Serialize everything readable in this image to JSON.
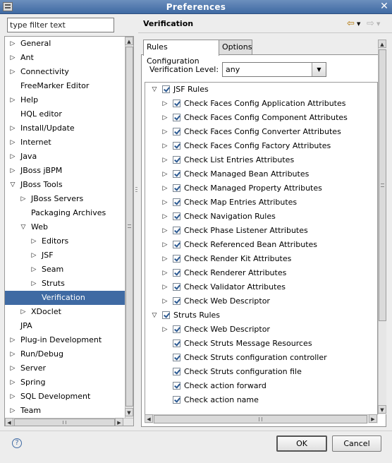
{
  "window": {
    "title": "Preferences",
    "close_glyph": "✕"
  },
  "filter": {
    "placeholder": "type filter text",
    "value": "type filter text"
  },
  "left_tree": [
    {
      "label": "General",
      "expander": "collapsed",
      "level": 0
    },
    {
      "label": "Ant",
      "expander": "collapsed",
      "level": 0
    },
    {
      "label": "Connectivity",
      "expander": "collapsed",
      "level": 0
    },
    {
      "label": "FreeMarker Editor",
      "expander": "none",
      "level": 0
    },
    {
      "label": "Help",
      "expander": "collapsed",
      "level": 0
    },
    {
      "label": "HQL editor",
      "expander": "none",
      "level": 0
    },
    {
      "label": "Install/Update",
      "expander": "collapsed",
      "level": 0
    },
    {
      "label": "Internet",
      "expander": "collapsed",
      "level": 0
    },
    {
      "label": "Java",
      "expander": "collapsed",
      "level": 0
    },
    {
      "label": "JBoss jBPM",
      "expander": "collapsed",
      "level": 0
    },
    {
      "label": "JBoss Tools",
      "expander": "expanded",
      "level": 0
    },
    {
      "label": "JBoss Servers",
      "expander": "collapsed",
      "level": 1
    },
    {
      "label": "Packaging Archives",
      "expander": "none",
      "level": 1
    },
    {
      "label": "Web",
      "expander": "expanded",
      "level": 1
    },
    {
      "label": "Editors",
      "expander": "collapsed",
      "level": 2
    },
    {
      "label": "JSF",
      "expander": "collapsed",
      "level": 2
    },
    {
      "label": "Seam",
      "expander": "collapsed",
      "level": 2
    },
    {
      "label": "Struts",
      "expander": "collapsed",
      "level": 2
    },
    {
      "label": "Verification",
      "expander": "none",
      "level": 2,
      "selected": true
    },
    {
      "label": "XDoclet",
      "expander": "collapsed",
      "level": 1
    },
    {
      "label": "JPA",
      "expander": "none",
      "level": 0
    },
    {
      "label": "Plug-in Development",
      "expander": "collapsed",
      "level": 0
    },
    {
      "label": "Run/Debug",
      "expander": "collapsed",
      "level": 0
    },
    {
      "label": "Server",
      "expander": "collapsed",
      "level": 0
    },
    {
      "label": "Spring",
      "expander": "collapsed",
      "level": 0
    },
    {
      "label": "SQL Development",
      "expander": "collapsed",
      "level": 0
    },
    {
      "label": "Team",
      "expander": "collapsed",
      "level": 0
    }
  ],
  "page": {
    "title": "Verification",
    "back_icon": "back-arrow-icon",
    "forward_icon": "forward-arrow-icon"
  },
  "tabs": [
    {
      "label": "Rules Configuration",
      "active": true
    },
    {
      "label": "Options",
      "active": false
    }
  ],
  "verification_level": {
    "label": "Verification Level:",
    "value": "any"
  },
  "rules": [
    {
      "label": "JSF Rules",
      "expander": "expanded",
      "level": 0,
      "checked": true
    },
    {
      "label": "Check Faces Config Application Attributes",
      "expander": "collapsed",
      "level": 1,
      "checked": true
    },
    {
      "label": "Check Faces Config Component Attributes",
      "expander": "collapsed",
      "level": 1,
      "checked": true
    },
    {
      "label": "Check Faces Config Converter Attributes",
      "expander": "collapsed",
      "level": 1,
      "checked": true
    },
    {
      "label": "Check Faces Config Factory Attributes",
      "expander": "collapsed",
      "level": 1,
      "checked": true
    },
    {
      "label": "Check List Entries Attributes",
      "expander": "collapsed",
      "level": 1,
      "checked": true
    },
    {
      "label": "Check Managed Bean Attributes",
      "expander": "collapsed",
      "level": 1,
      "checked": true
    },
    {
      "label": "Check Managed Property Attributes",
      "expander": "collapsed",
      "level": 1,
      "checked": true
    },
    {
      "label": "Check Map Entries Attributes",
      "expander": "collapsed",
      "level": 1,
      "checked": true
    },
    {
      "label": "Check Navigation Rules",
      "expander": "collapsed",
      "level": 1,
      "checked": true
    },
    {
      "label": "Check Phase Listener Attributes",
      "expander": "collapsed",
      "level": 1,
      "checked": true
    },
    {
      "label": "Check Referenced Bean Attributes",
      "expander": "collapsed",
      "level": 1,
      "checked": true
    },
    {
      "label": "Check Render Kit Attributes",
      "expander": "collapsed",
      "level": 1,
      "checked": true
    },
    {
      "label": "Check Renderer Attributes",
      "expander": "collapsed",
      "level": 1,
      "checked": true
    },
    {
      "label": "Check Validator Attributes",
      "expander": "collapsed",
      "level": 1,
      "checked": true
    },
    {
      "label": "Check Web Descriptor",
      "expander": "collapsed",
      "level": 1,
      "checked": true
    },
    {
      "label": "Struts Rules",
      "expander": "expanded",
      "level": 0,
      "checked": true
    },
    {
      "label": "Check Web Descriptor",
      "expander": "collapsed",
      "level": 1,
      "checked": true
    },
    {
      "label": "Check Struts Message Resources",
      "expander": "none",
      "level": 1,
      "checked": true
    },
    {
      "label": "Check Struts configuration controller",
      "expander": "none",
      "level": 1,
      "checked": true
    },
    {
      "label": "Check Struts configuration file",
      "expander": "none",
      "level": 1,
      "checked": true
    },
    {
      "label": "Check action forward",
      "expander": "none",
      "level": 1,
      "checked": true
    },
    {
      "label": "Check action name",
      "expander": "none",
      "level": 1,
      "checked": true
    }
  ],
  "buttons": {
    "ok": "OK",
    "cancel": "Cancel"
  },
  "colors": {
    "titlebar": "#3f6aa3",
    "selection": "#3f6aa3",
    "checkmark": "#2c5a93"
  }
}
